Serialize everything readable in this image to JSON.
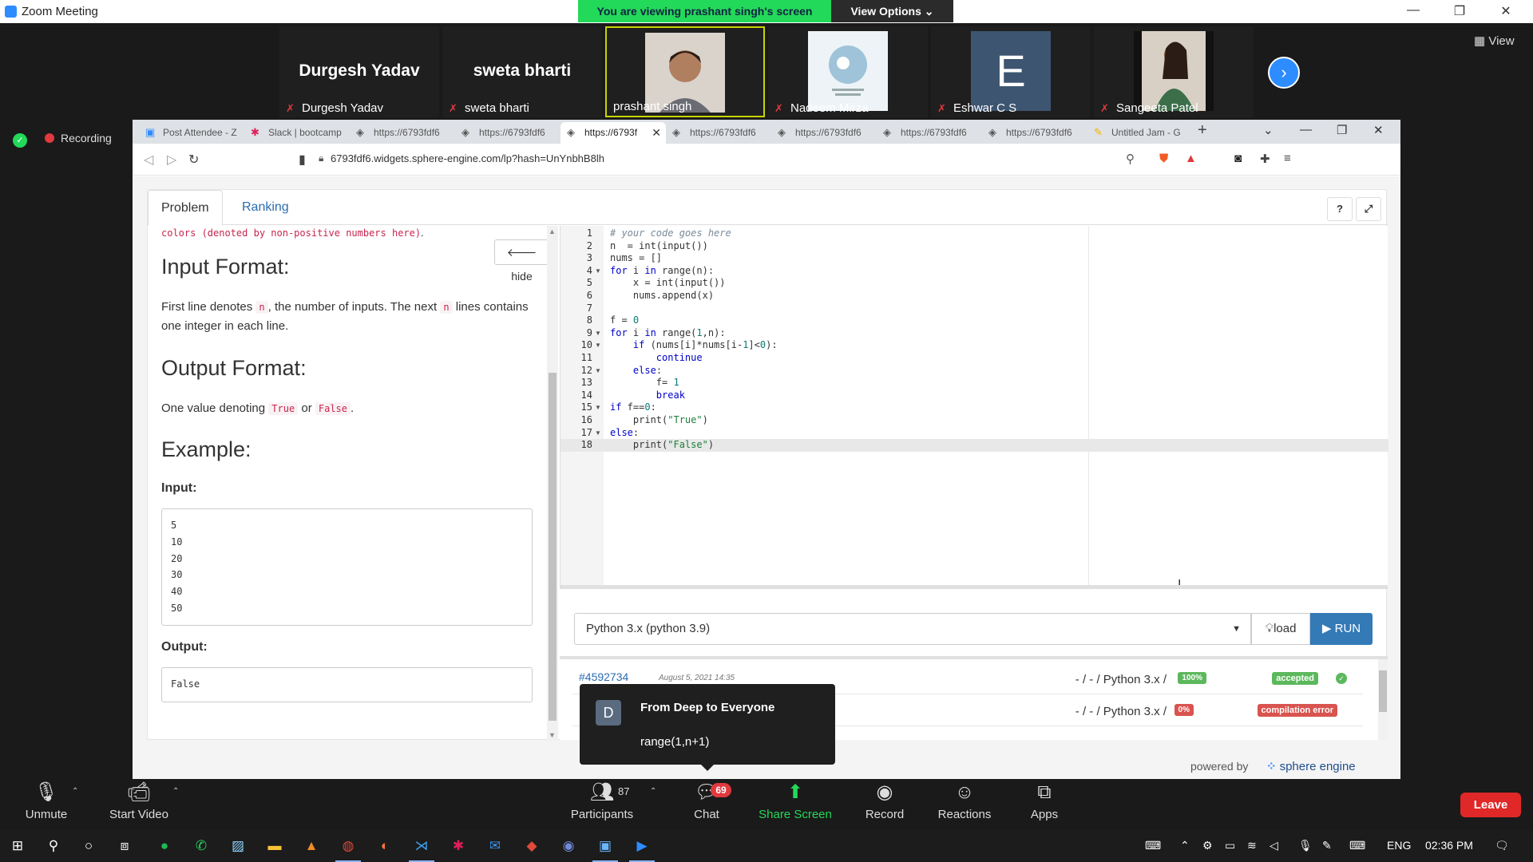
{
  "window": {
    "title": "Zoom Meeting",
    "viewing_banner": "You are viewing prashant singh's screen",
    "view_options": "View Options"
  },
  "participants": {
    "tiles": [
      {
        "big_name": "Durgesh Yadav",
        "name": "Durgesh Yadav",
        "muted": true
      },
      {
        "big_name": "sweta bharti",
        "name": "sweta bharti",
        "muted": true
      },
      {
        "big_name": "",
        "name": "prashant singh",
        "muted": false
      },
      {
        "big_name": "",
        "name": "Nadeem Mirza",
        "muted": true
      },
      {
        "big_name": "E",
        "name": "Eshwar C S",
        "muted": true
      },
      {
        "big_name": "",
        "name": "Sangeeta Patel",
        "muted": true
      }
    ],
    "view_label": "View"
  },
  "recording": {
    "label": "Recording"
  },
  "browser": {
    "tabs": [
      {
        "title": "Post Attendee - Z"
      },
      {
        "title": "Slack | bootcamp"
      },
      {
        "title": "https://6793fdf6"
      },
      {
        "title": "https://6793fdf6"
      },
      {
        "title": "https://6793f"
      },
      {
        "title": "https://6793fdf6"
      },
      {
        "title": "https://6793fdf6"
      },
      {
        "title": "https://6793fdf6"
      },
      {
        "title": "https://6793fdf6"
      },
      {
        "title": "Untitled Jam - G"
      }
    ],
    "url": "6793fdf6.widgets.sphere-engine.com/lp?hash=UnYnbhB8lh"
  },
  "problem": {
    "tabs": [
      "Problem",
      "Ranking"
    ],
    "help_label": "?",
    "hide_label": "hide",
    "top_code": "colors (denoted by non-positive numbers here)",
    "top_code_suffix": ".",
    "input_heading": "Input Format:",
    "input_text_1": "First line denotes",
    "input_code_n": "n",
    "input_text_2": ", the number of inputs. The next",
    "input_code_n2": "n",
    "input_text_3": "lines contains one integer in each line.",
    "output_heading": "Output Format:",
    "output_text_1": "One value denoting",
    "output_code_true": "True",
    "output_text_or": "or",
    "output_code_false": "False",
    "output_text_end": ".",
    "example_heading": "Example:",
    "input_label": "Input:",
    "input_values": [
      "5",
      "10",
      "20",
      "30",
      "40",
      "50"
    ],
    "output_label": "Output:",
    "output_value": "False"
  },
  "editor": {
    "lines": [
      "# your code goes here",
      "n  = int(input())",
      "nums = []",
      "for i in range(n):",
      "    x = int(input())",
      "    nums.append(x)",
      "",
      "f = 0",
      "for i in range(1,n):",
      "    if (nums[i]*nums[i-1]<0):",
      "        continue",
      "    else:",
      "        f= 1",
      "        break",
      "if f==0:",
      "    print(\"True\")",
      "else:",
      "    print(\"False\")"
    ],
    "language": "Python 3.x (python 3.9)",
    "load_label": "load",
    "run_label": "RUN"
  },
  "submissions": [
    {
      "id": "#4592734",
      "date": "August 5, 2021 14:35",
      "lang": "- / - / Python 3.x /",
      "score": "100%",
      "status": "accepted"
    },
    {
      "id": "",
      "date": "",
      "lang": "- / - / Python 3.x /",
      "score": "0%",
      "status": "compilation error"
    }
  ],
  "footer": {
    "powered_by": "powered by",
    "brand": "sphere engine"
  },
  "chat_popup": {
    "avatar": "D",
    "from": "From Deep to Everyone",
    "message": "range(1,n+1)"
  },
  "controls": {
    "unmute": "Unmute",
    "start_video": "Start Video",
    "participants": "Participants",
    "participants_count": "87",
    "chat": "Chat",
    "chat_badge": "69",
    "share_screen": "Share Screen",
    "record": "Record",
    "reactions": "Reactions",
    "apps": "Apps",
    "leave": "Leave"
  },
  "taskbar": {
    "lang": "ENG",
    "time": "02:36 PM"
  }
}
